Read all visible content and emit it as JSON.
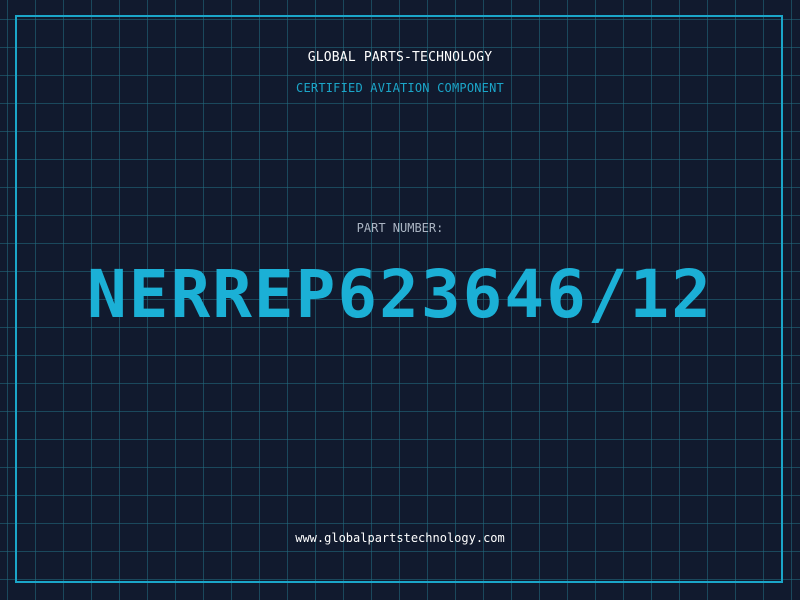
{
  "header": {
    "company": "GLOBAL PARTS-TECHNOLOGY",
    "subtitle": "CERTIFIED AVIATION COMPONENT"
  },
  "part": {
    "label": "PART NUMBER:",
    "number": "NERREP623646/12"
  },
  "footer": {
    "url": "www.globalpartstechnology.com"
  },
  "colors": {
    "background": "#111a2e",
    "grid": "#226e82",
    "accent": "#1bb0d6",
    "text": "#ffffff",
    "label": "#aab4c2"
  }
}
